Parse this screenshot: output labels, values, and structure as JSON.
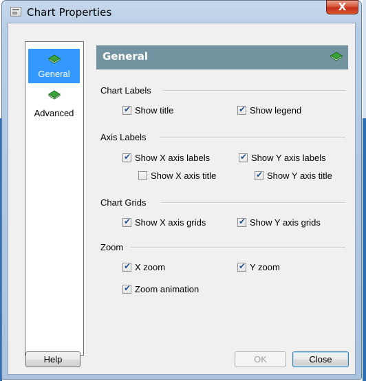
{
  "window": {
    "title": "Chart Properties",
    "close_glyph": "X"
  },
  "nav": {
    "items": [
      {
        "label": "General",
        "icon": "green-book-icon",
        "selected": true
      },
      {
        "label": "Advanced",
        "icon": "green-book-icon",
        "selected": false
      }
    ]
  },
  "header": {
    "title": "General",
    "icon": "green-book-icon",
    "color": "#7393a0"
  },
  "groups": {
    "chart_labels": {
      "title": "Chart Labels",
      "show_title": {
        "label": "Show title",
        "checked": true
      },
      "show_legend": {
        "label": "Show legend",
        "checked": true
      }
    },
    "axis_labels": {
      "title": "Axis Labels",
      "show_x_axis_labels": {
        "label": "Show X axis labels",
        "checked": true
      },
      "show_y_axis_labels": {
        "label": "Show Y axis labels",
        "checked": true
      },
      "show_x_axis_title": {
        "label": "Show X axis title",
        "checked": false
      },
      "show_y_axis_title": {
        "label": "Show Y axis title",
        "checked": true
      }
    },
    "chart_grids": {
      "title": "Chart Grids",
      "show_x_axis_grids": {
        "label": "Show X axis grids",
        "checked": true
      },
      "show_y_axis_grids": {
        "label": "Show Y axis grids",
        "checked": true
      }
    },
    "zoom": {
      "title": "Zoom",
      "x_zoom": {
        "label": "X zoom",
        "checked": true
      },
      "y_zoom": {
        "label": "Y zoom",
        "checked": true
      },
      "zoom_animation": {
        "label": "Zoom animation",
        "checked": true
      }
    }
  },
  "buttons": {
    "help": "Help",
    "ok": {
      "label": "OK",
      "enabled": false
    },
    "close": "Close"
  }
}
